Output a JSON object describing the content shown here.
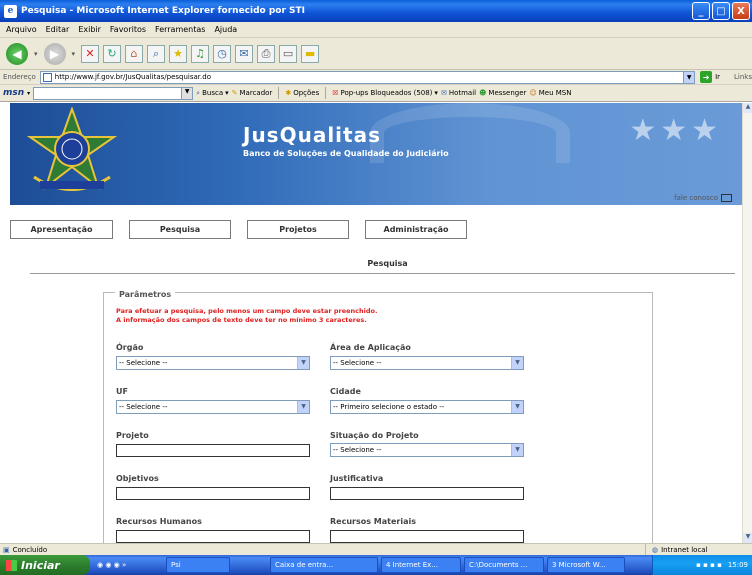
{
  "window": {
    "title": "Pesquisa - Microsoft Internet Explorer fornecido por STI",
    "minimize": "_",
    "maximize": "□",
    "close": "X"
  },
  "menu": [
    "Arquivo",
    "Editar",
    "Exibir",
    "Favoritos",
    "Ferramentas",
    "Ajuda"
  ],
  "address": {
    "label": "Endereço",
    "url": "http://www.jf.gov.br/JusQualitas/pesquisar.do",
    "go_label": "Ir",
    "links_label": "Links"
  },
  "msnbar": {
    "logo": "msn",
    "busca": "Busca",
    "marcador": "Marcador",
    "opcoes": "Opções",
    "popups": "Pop-ups Bloqueados (508)",
    "hotmail": "Hotmail",
    "messenger": "Messenger",
    "meumsn": "Meu MSN"
  },
  "site": {
    "title": "JusQualitas",
    "subtitle": "Banco de Soluções de Qualidade do Judiciário",
    "contact": "fale conosco",
    "nav": [
      "Apresentação",
      "Pesquisa",
      "Projetos",
      "Administração"
    ]
  },
  "page": {
    "title": "Pesquisa",
    "fieldset_legend": "Parâmetros",
    "warning_line1": "Para efetuar a pesquisa, pelo menos um campo deve estar preenchido.",
    "warning_line2": "A informação dos campos de texto deve ter no mínimo 3 caracteres."
  },
  "form": {
    "orgao_label": "Órgão",
    "orgao_value": "-- Selecione --",
    "area_label": "Área de Aplicação",
    "area_value": "-- Selecione --",
    "uf_label": "UF",
    "uf_value": "-- Selecione --",
    "cidade_label": "Cidade",
    "cidade_value": "-- Primeiro selecione o estado --",
    "projeto_label": "Projeto",
    "situacao_label": "Situação do Projeto",
    "situacao_value": "-- Selecione --",
    "objetivos_label": "Objetivos",
    "justificativa_label": "Justificativa",
    "rh_label": "Recursos Humanos",
    "rm_label": "Recursos Materiais"
  },
  "status": {
    "text": "Concluído",
    "zone": "Intranet local"
  },
  "taskbar": {
    "start": "Iniciar",
    "tasks": [
      "Psi",
      "Caixa de entra...",
      "4 Internet Ex...",
      "C:\\Documents ...",
      "3 Microsoft W..."
    ],
    "clock": "15:09"
  },
  "colors": {
    "header_blue": "#2f6ab8",
    "warning_red": "#e02020",
    "taskbar_blue": "#2456c7"
  }
}
